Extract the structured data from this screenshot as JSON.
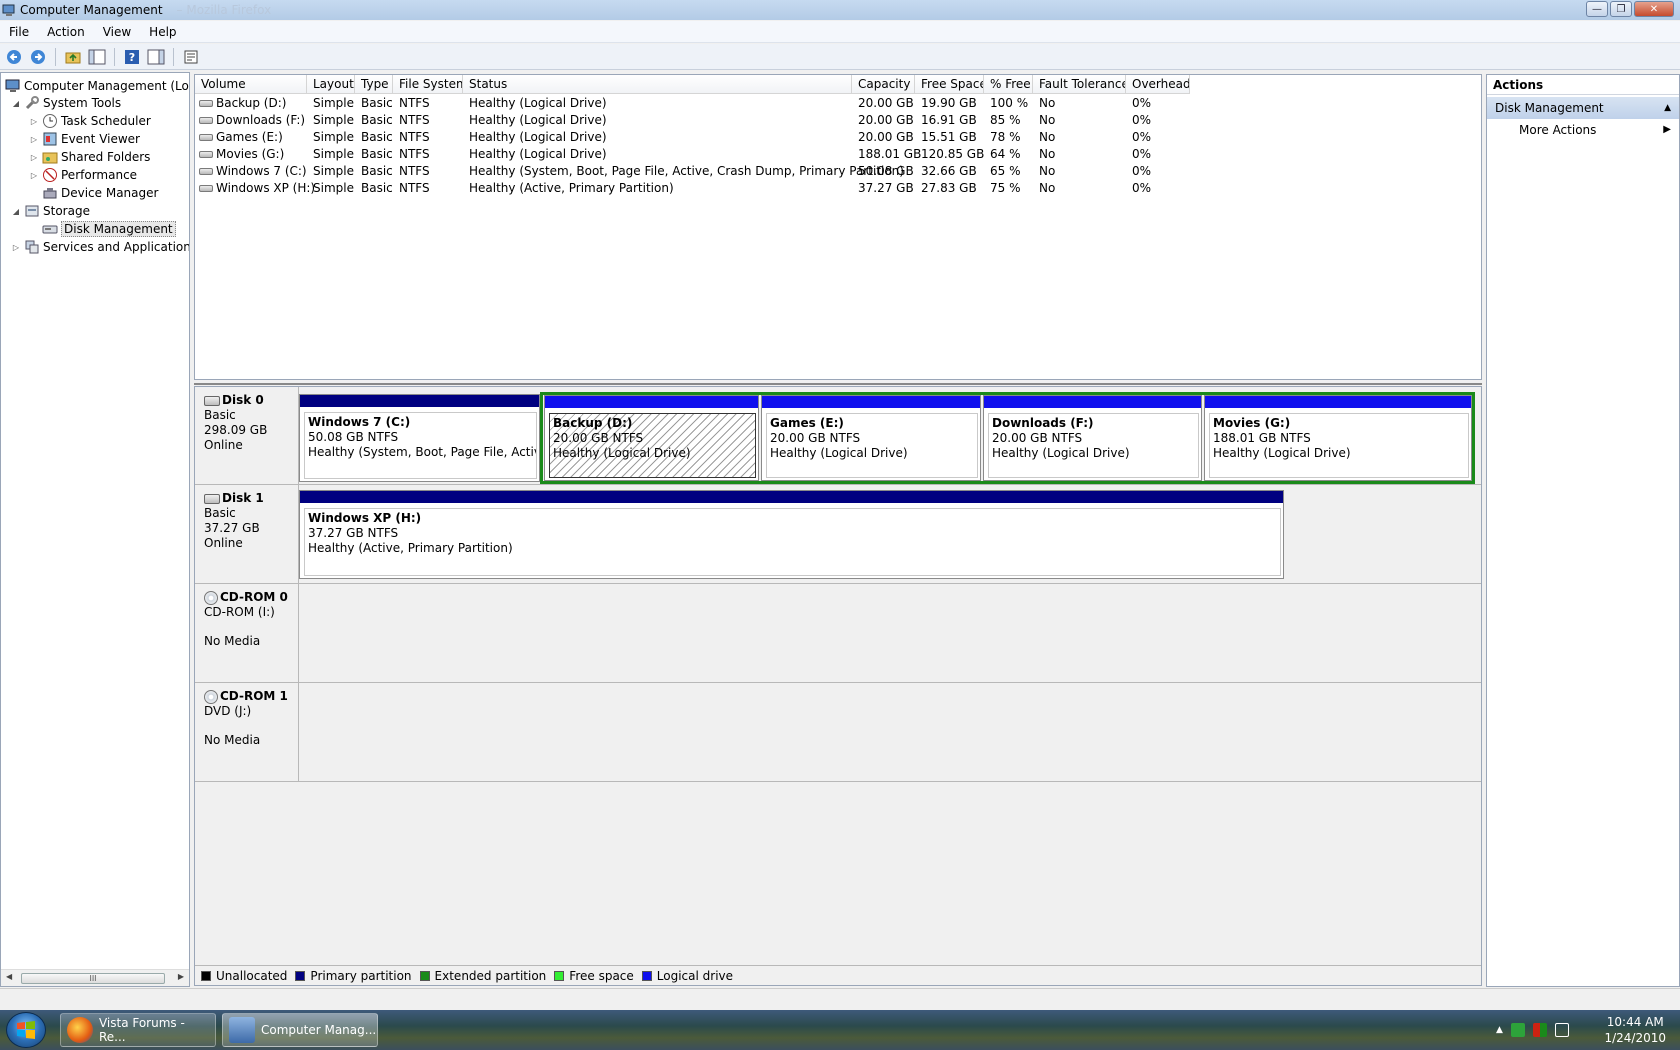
{
  "window": {
    "title": "Computer Management",
    "ghost_title": "– Mozilla Firefox",
    "controls": {
      "minimize": "—",
      "maximize": "❐",
      "close": "✕"
    }
  },
  "menu": [
    "File",
    "Action",
    "View",
    "Help"
  ],
  "toolbar": {
    "buttons": [
      "back-icon",
      "forward-icon",
      "up-folder-icon",
      "show-hide-tree-icon",
      "help-icon",
      "show-hide-action-pane-icon",
      "properties-icon"
    ]
  },
  "tree": {
    "root": "Computer Management (Local",
    "system_tools": "System Tools",
    "task_scheduler": "Task Scheduler",
    "event_viewer": "Event Viewer",
    "shared_folders": "Shared Folders",
    "performance": "Performance",
    "device_manager": "Device Manager",
    "storage": "Storage",
    "disk_management": "Disk Management",
    "services": "Services and Applications",
    "scroll_grip": "III"
  },
  "volume_list": {
    "headers": [
      "Volume",
      "Layout",
      "Type",
      "File System",
      "Status",
      "Capacity",
      "Free Space",
      "% Free",
      "Fault Tolerance",
      "Overhead"
    ],
    "rows": [
      [
        "Backup (D:)",
        "Simple",
        "Basic",
        "NTFS",
        "Healthy (Logical Drive)",
        "20.00 GB",
        "19.90 GB",
        "100 %",
        "No",
        "0%"
      ],
      [
        "Downloads (F:)",
        "Simple",
        "Basic",
        "NTFS",
        "Healthy (Logical Drive)",
        "20.00 GB",
        "16.91 GB",
        "85 %",
        "No",
        "0%"
      ],
      [
        "Games (E:)",
        "Simple",
        "Basic",
        "NTFS",
        "Healthy (Logical Drive)",
        "20.00 GB",
        "15.51 GB",
        "78 %",
        "No",
        "0%"
      ],
      [
        "Movies (G:)",
        "Simple",
        "Basic",
        "NTFS",
        "Healthy (Logical Drive)",
        "188.01 GB",
        "120.85 GB",
        "64 %",
        "No",
        "0%"
      ],
      [
        "Windows 7 (C:)",
        "Simple",
        "Basic",
        "NTFS",
        "Healthy (System, Boot, Page File, Active, Crash Dump, Primary Partition)",
        "50.08 GB",
        "32.66 GB",
        "65 %",
        "No",
        "0%"
      ],
      [
        "Windows XP (H:)",
        "Simple",
        "Basic",
        "NTFS",
        "Healthy (Active, Primary Partition)",
        "37.27 GB",
        "27.83 GB",
        "75 %",
        "No",
        "0%"
      ]
    ]
  },
  "disks": {
    "disk0": {
      "name": "Disk 0",
      "type": "Basic",
      "size": "298.09 GB",
      "state": "Online"
    },
    "disk1": {
      "name": "Disk 1",
      "type": "Basic",
      "size": "37.27 GB",
      "state": "Online"
    },
    "cdrom0": {
      "name": "CD-ROM 0",
      "type": "CD-ROM (I:)",
      "state": "No Media"
    },
    "cdrom1": {
      "name": "CD-ROM 1",
      "type": "DVD (J:)",
      "state": "No Media"
    }
  },
  "partitions": {
    "c": {
      "name": "Windows 7  (C:)",
      "size": "50.08 GB NTFS",
      "status": "Healthy (System, Boot, Page File, Active, Cr"
    },
    "d": {
      "name": "Backup  (D:)",
      "size": "20.00 GB NTFS",
      "status": "Healthy (Logical Drive)"
    },
    "e": {
      "name": "Games  (E:)",
      "size": "20.00 GB NTFS",
      "status": "Healthy (Logical Drive)"
    },
    "f": {
      "name": "Downloads  (F:)",
      "size": "20.00 GB NTFS",
      "status": "Healthy (Logical Drive)"
    },
    "g": {
      "name": "Movies  (G:)",
      "size": "188.01 GB NTFS",
      "status": "Healthy (Logical Drive)"
    },
    "h": {
      "name": "Windows XP  (H:)",
      "size": "37.27 GB NTFS",
      "status": "Healthy (Active, Primary Partition)"
    }
  },
  "legend": {
    "unallocated": "Unallocated",
    "primary": "Primary partition",
    "extended": "Extended partition",
    "free": "Free space",
    "logical": "Logical drive"
  },
  "colors": {
    "unallocated": "#000000",
    "primary": "#000080",
    "extended": "#1a8a1a",
    "free": "#33ee33",
    "logical": "#1010ee"
  },
  "actions": {
    "header": "Actions",
    "section": "Disk Management",
    "more": "More Actions"
  },
  "taskbar": {
    "tasks": [
      "Vista Forums - Re...",
      "Computer Manag..."
    ],
    "time": "10:44 AM",
    "date": "1/24/2010"
  }
}
